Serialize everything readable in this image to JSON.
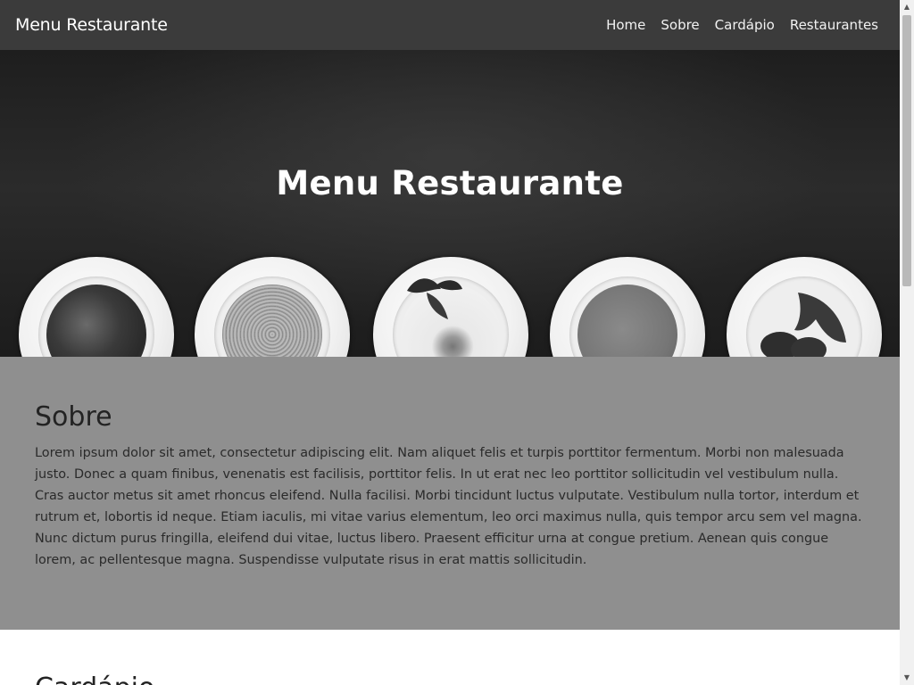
{
  "navbar": {
    "brand": "Menu Restaurante",
    "links": [
      "Home",
      "Sobre",
      "Cardápio",
      "Restaurantes"
    ]
  },
  "hero": {
    "title": "Menu Restaurante",
    "plate_images": [
      "soup-plate",
      "pasta-plate",
      "egg-herb-plate",
      "cream-soup-plate",
      "croissant-plate"
    ]
  },
  "about": {
    "heading": "Sobre",
    "text": "Lorem ipsum dolor sit amet, consectetur adipiscing elit. Nam aliquet felis et turpis porttitor fermentum. Morbi non malesuada justo. Donec a quam finibus, venenatis est facilisis, porttitor felis. In ut erat nec leo porttitor sollicitudin vel vestibulum nulla. Cras auctor metus sit amet rhoncus eleifend. Nulla facilisi. Morbi tincidunt luctus vulputate. Vestibulum nulla tortor, interdum et rutrum et, lobortis id neque. Etiam iaculis, mi vitae varius elementum, leo orci maximus nulla, quis tempor arcu sem vel magna. Nunc dictum purus fringilla, eleifend dui vitae, luctus libero. Praesent efficitur urna at congue pretium. Aenean quis congue lorem, ac pellentesque magna. Suspendisse vulputate risus in erat mattis sollicitudin."
  },
  "menu_section": {
    "heading": "Cardápio"
  },
  "colors": {
    "navbar_bg": "#3b3b3b",
    "hero_bg": "#1e1e1e",
    "about_bg": "#8f8f8f",
    "page_bg": "#ffffff"
  }
}
